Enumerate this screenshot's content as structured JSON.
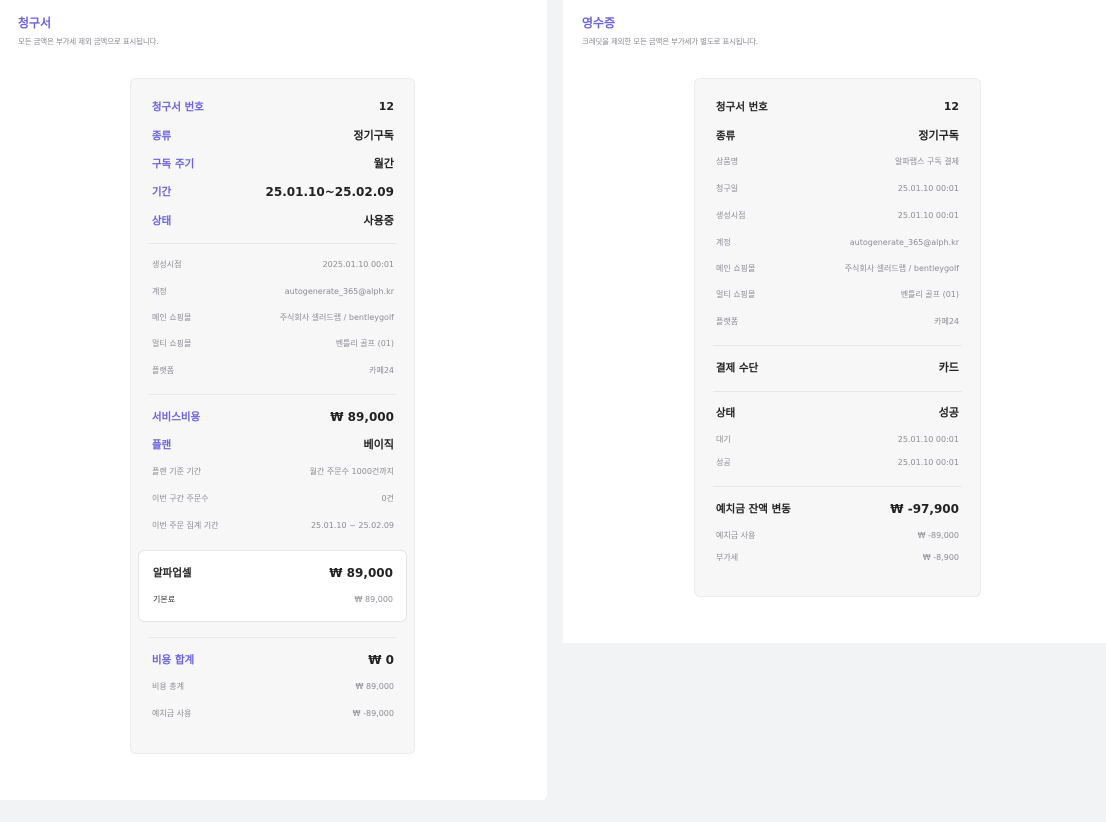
{
  "invoice": {
    "title": "청구서",
    "subtitle": "모든 금액은 부가세 제외 금액으로 표시됩니다.",
    "summary": [
      {
        "label": "청구서 번호",
        "value": "12"
      },
      {
        "label": "종류",
        "value": "정기구독"
      },
      {
        "label": "구독 주기",
        "value": "월간"
      },
      {
        "label": "기간",
        "value": "25.01.10~25.02.09"
      },
      {
        "label": "상태",
        "value": "사용중"
      }
    ],
    "details": [
      {
        "label": "생성시점",
        "value": "2025.01.10 00:01"
      },
      {
        "label": "계정",
        "value": "autogenerate_365@alph.kr"
      },
      {
        "label": "메인 쇼핑몰",
        "value": "주식회사 셀러드랩 / bentleygolf"
      },
      {
        "label": "멀티 쇼핑몰",
        "value": "벤틀리 골프 (01)"
      },
      {
        "label": "플랫폼",
        "value": "카페24"
      }
    ],
    "service": {
      "cost_label": "서비스비용",
      "cost_value": "₩ 89,000",
      "plan_label": "플랜",
      "plan_value": "베이직",
      "items": [
        {
          "label": "플랜 기준 기간",
          "value": "월간 주문수 1000건까지"
        },
        {
          "label": "이번 구간 주문수",
          "value": "0건"
        },
        {
          "label": "이번 주문 집계 기간",
          "value": "25.01.10 ~ 25.02.09"
        }
      ]
    },
    "upsell": {
      "name": "알파업셀",
      "amount": "₩ 89,000",
      "fee_label": "기본료",
      "fee_value": "₩ 89,000"
    },
    "total": {
      "label": "비용 합계",
      "value": "₩ 0",
      "items": [
        {
          "label": "비용 총계",
          "value": "₩ 89,000"
        },
        {
          "label": "예치금 사용",
          "value": "₩ -89,000"
        }
      ]
    }
  },
  "receipt": {
    "title": "영수증",
    "subtitle": "크레딧을 제외한 모든 금액은 부가세가 별도로 표시됩니다.",
    "summary": [
      {
        "label": "청구서 번호",
        "value": "12"
      },
      {
        "label": "종류",
        "value": "정기구독"
      }
    ],
    "details": [
      {
        "label": "상품명",
        "value": "알파랩스 구독 결제"
      },
      {
        "label": "청구일",
        "value": "25.01.10 00:01"
      },
      {
        "label": "생성시점",
        "value": "25.01.10 00:01"
      },
      {
        "label": "계정",
        "value": "autogenerate_365@alph.kr"
      },
      {
        "label": "메인 쇼핑몰",
        "value": "주식회사 셀러드랩 / bentleygolf"
      },
      {
        "label": "멀티 쇼핑몰",
        "value": "벤틀리 골프 (01)"
      },
      {
        "label": "플랫폼",
        "value": "카페24"
      }
    ],
    "payment": {
      "label": "결제 수단",
      "value": "카드"
    },
    "status": {
      "label": "상태",
      "value": "성공",
      "items": [
        {
          "label": "대기",
          "value": "25.01.10 00:01"
        },
        {
          "label": "성공",
          "value": "25.01.10 00:01"
        }
      ]
    },
    "deposit": {
      "label": "예치금 잔액 변동",
      "value": "₩ -97,900",
      "items": [
        {
          "label": "예치금 사용",
          "value": "₩ -89,000"
        },
        {
          "label": "부가세",
          "value": "₩ -8,900"
        }
      ]
    }
  }
}
